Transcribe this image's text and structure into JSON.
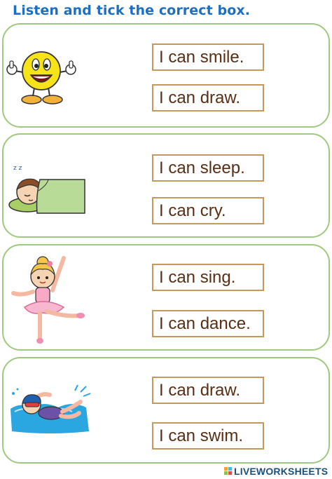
{
  "instruction": "Listen and tick the correct box.",
  "panels": [
    {
      "picture": "smiley-thumbs-up",
      "options": [
        "I can smile.",
        "I can draw."
      ]
    },
    {
      "picture": "sleeping-boy",
      "options": [
        "I can sleep.",
        "I can cry."
      ]
    },
    {
      "picture": "ballerina-girl",
      "options": [
        "I can sing.",
        "I can dance."
      ]
    },
    {
      "picture": "swimming-girl",
      "options": [
        "I can draw.",
        "I can swim."
      ]
    }
  ],
  "footer": {
    "brand": "LIVEWORKSHEETS"
  },
  "colors": {
    "title": "#1f6fc0",
    "panel_border": "#9fc97e",
    "box_border": "#c5995d",
    "box_text": "#5a2e14"
  }
}
